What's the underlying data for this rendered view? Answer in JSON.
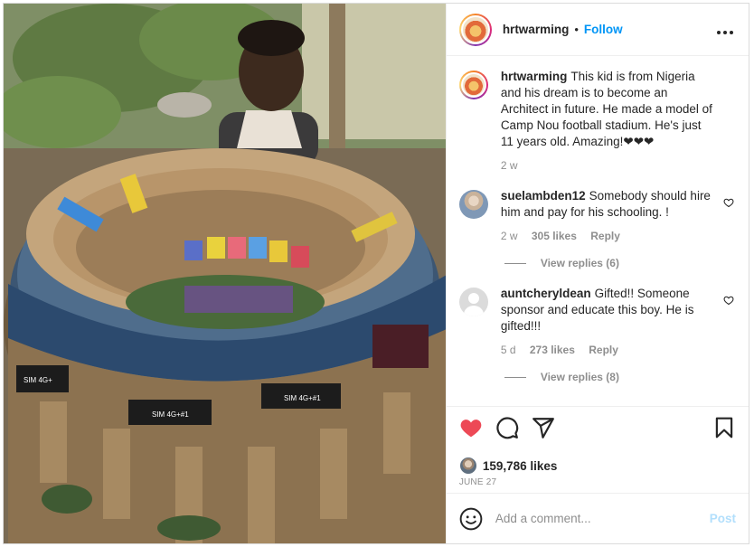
{
  "header": {
    "username": "hrtwarming",
    "separator": "•",
    "follow_label": "Follow",
    "more_icon": "more-horizontal-icon"
  },
  "caption": {
    "username": "hrtwarming",
    "text": "This kid is from Nigeria and his dream is to become an Architect in future. He made a model of Camp Nou football stadium. He's just 11 years old. Amazing!❤❤❤",
    "time": "2 w"
  },
  "comments": [
    {
      "username": "suelambden12",
      "text": "Somebody should hire him and pay for his schooling. !",
      "time": "2 w",
      "likes": "305 likes",
      "reply_label": "Reply",
      "view_replies": "View replies (6)"
    },
    {
      "username": "auntcheryldean",
      "text": "Gifted!! Someone sponsor and educate this boy. He is gifted!!!",
      "time": "5 d",
      "likes": "273 likes",
      "reply_label": "Reply",
      "view_replies": "View replies (8)"
    }
  ],
  "post_stats": {
    "likes": "159,786 likes",
    "date": "JUNE 27",
    "liked": true
  },
  "add_comment": {
    "placeholder": "Add a comment...",
    "post_label": "Post"
  },
  "colors": {
    "like_red": "#ed4956",
    "link_blue": "#0095f6",
    "post_disabled": "#b2dffc",
    "muted": "#8e8e8e"
  },
  "icons": [
    "heart-icon",
    "comment-icon",
    "share-icon",
    "bookmark-icon",
    "emoji-icon",
    "heart-outline-icon",
    "more-horizontal-icon"
  ],
  "image": {
    "stadium_panel_labels": [
      "SIM 4G+#1",
      "SIM 4G+",
      "SIM 4G+#1"
    ]
  }
}
